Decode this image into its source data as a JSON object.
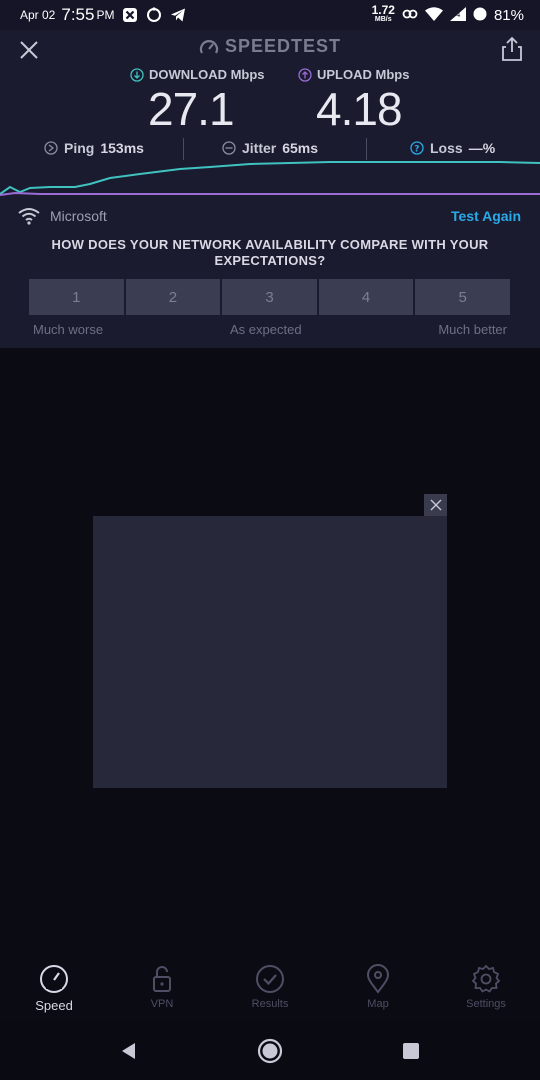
{
  "status_bar": {
    "date": "Apr 02",
    "time": "7:55",
    "ampm": "PM",
    "net_speed": "1.72",
    "net_speed_unit": "MB/s",
    "battery": "81%"
  },
  "header": {
    "title": "SPEEDTEST"
  },
  "metrics": {
    "download_label": "DOWNLOAD Mbps",
    "download_value": "27.1",
    "upload_label": "UPLOAD Mbps",
    "upload_value": "4.18"
  },
  "stats": {
    "ping_label": "Ping",
    "ping_value": "153ms",
    "jitter_label": "Jitter",
    "jitter_value": "65ms",
    "loss_label": "Loss",
    "loss_value": "—%"
  },
  "network": {
    "provider": "Microsoft",
    "test_again": "Test Again"
  },
  "survey": {
    "question": "HOW DOES YOUR NETWORK AVAILABILITY COMPARE WITH YOUR EXPECTATIONS?",
    "options": [
      "1",
      "2",
      "3",
      "4",
      "5"
    ],
    "scale_left": "Much worse",
    "scale_middle": "As expected",
    "scale_right": "Much better"
  },
  "tabs": [
    {
      "label": "Speed",
      "icon": "speedometer-icon",
      "active": true
    },
    {
      "label": "VPN",
      "icon": "unlock-icon",
      "active": false
    },
    {
      "label": "Results",
      "icon": "check-circle-icon",
      "active": false
    },
    {
      "label": "Map",
      "icon": "map-pin-icon",
      "active": false
    },
    {
      "label": "Settings",
      "icon": "gear-icon",
      "active": false
    }
  ],
  "colors": {
    "accent_blue": "#2aa9e8",
    "download_line": "#3fc2c0",
    "upload_line": "#9b6bd6",
    "panel_bg": "#1a1b2e"
  }
}
